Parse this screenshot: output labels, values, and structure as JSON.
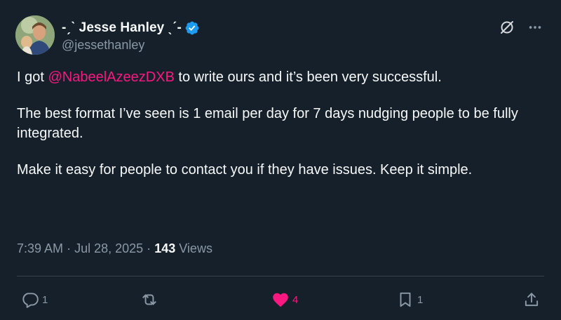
{
  "author": {
    "display_name": "-ˏˋ Jesse Hanley ˎˊ-",
    "handle": "@jessethanley",
    "verified": true
  },
  "tweet": {
    "paragraphs": [
      {
        "before": "I got ",
        "mention": "@NabeelAzeezDXB",
        "after": " to write ours and it’s been very successful."
      },
      {
        "text": "The best format I’ve seen is 1 email per day for 7 days nudging people to be fully integrated."
      },
      {
        "text": "Make it easy for people to contact you if they have issues. Keep it simple."
      }
    ]
  },
  "meta": {
    "time": "7:39 AM",
    "separator": "·",
    "date": "Jul 28, 2025",
    "views_count": "143",
    "views_label": "Views"
  },
  "actions": {
    "reply_count": "1",
    "retweet_count": "",
    "like_count": "4",
    "bookmark_count": "1"
  },
  "icons": {
    "verified": "verified-badge-icon",
    "grok": "grok-icon",
    "more": "more-icon",
    "reply": "reply-icon",
    "retweet": "retweet-icon",
    "like": "heart-icon",
    "bookmark": "bookmark-icon",
    "share": "share-icon"
  },
  "colors": {
    "background": "#15202b",
    "text": "#f7f9f9",
    "muted": "#8b98a5",
    "accent_pink": "#f91880",
    "verified_blue": "#1d9bf0",
    "divider": "#38444d"
  }
}
